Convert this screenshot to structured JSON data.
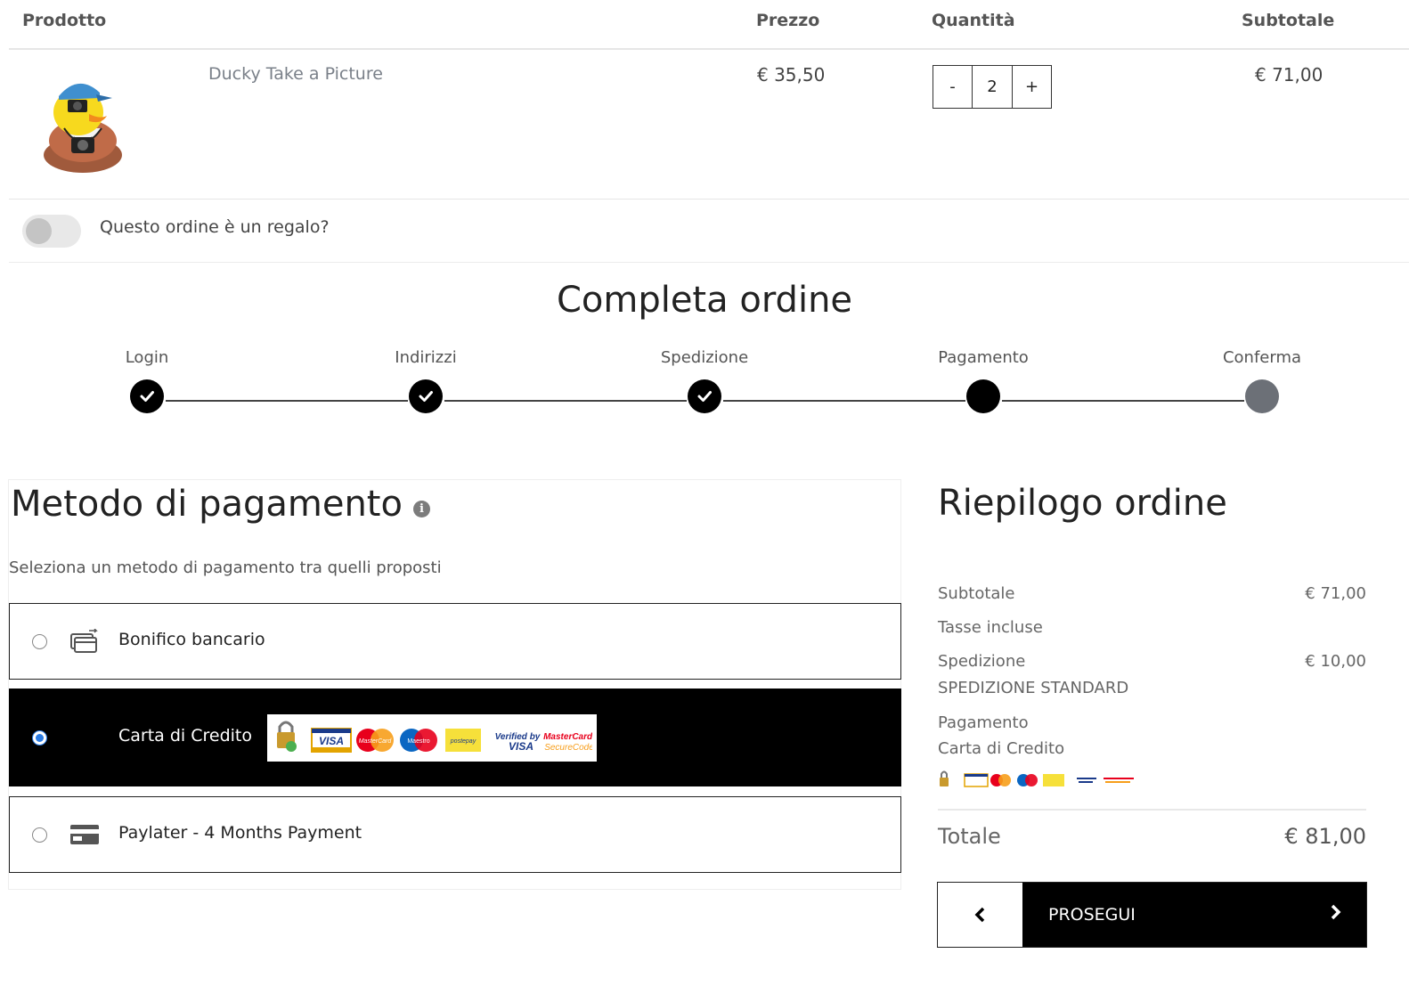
{
  "cart": {
    "headers": {
      "product": "Prodotto",
      "price": "Prezzo",
      "quantity": "Quantità",
      "subtotal": "Subtotale"
    },
    "item": {
      "name": "Ducky Take a Picture",
      "price": "€ 35,50",
      "quantity": "2",
      "qty_minus": "-",
      "qty_plus": "+",
      "subtotal": "€ 71,00"
    },
    "gift_label": "Questo ordine è un regalo?"
  },
  "checkout": {
    "title": "Completa ordine",
    "steps": [
      {
        "label": "Login",
        "state": "done"
      },
      {
        "label": "Indirizzi",
        "state": "done"
      },
      {
        "label": "Spedizione",
        "state": "done"
      },
      {
        "label": "Pagamento",
        "state": "current"
      },
      {
        "label": "Conferma",
        "state": "pending"
      }
    ]
  },
  "payment": {
    "title": "Metodo di pagamento",
    "info_icon": "i",
    "subtitle": "Seleziona un metodo di pagamento tra quelli proposti",
    "methods": [
      {
        "label": "Bonifico bancario",
        "icon": "bank-transfer-icon",
        "selected": false
      },
      {
        "label": "Carta di Credito",
        "icon": "credit-card-logos",
        "selected": true
      },
      {
        "label": "Paylater - 4 Months Payment",
        "icon": "card-icon",
        "selected": false
      }
    ],
    "card_logos": [
      "VISA",
      "MasterCard",
      "Maestro",
      "postepay",
      "Verified by",
      "VISA",
      "MasterCard.",
      "SecureCode"
    ]
  },
  "summary": {
    "title": "Riepilogo ordine",
    "subtotal_label": "Subtotale",
    "subtotal_value": "€ 71,00",
    "taxes_label": "Tasse incluse",
    "shipping_label": "Spedizione",
    "shipping_value": "€ 10,00",
    "shipping_method": "SPEDIZIONE STANDARD",
    "payment_label": "Pagamento",
    "payment_method": "Carta di Credito",
    "total_label": "Totale",
    "total_value": "€ 81,00",
    "next_label": "PROSEGUI"
  },
  "colors": {
    "selected_bg": "#000000",
    "radio_on": "#2a7be4",
    "step_pending": "#6c7077"
  }
}
